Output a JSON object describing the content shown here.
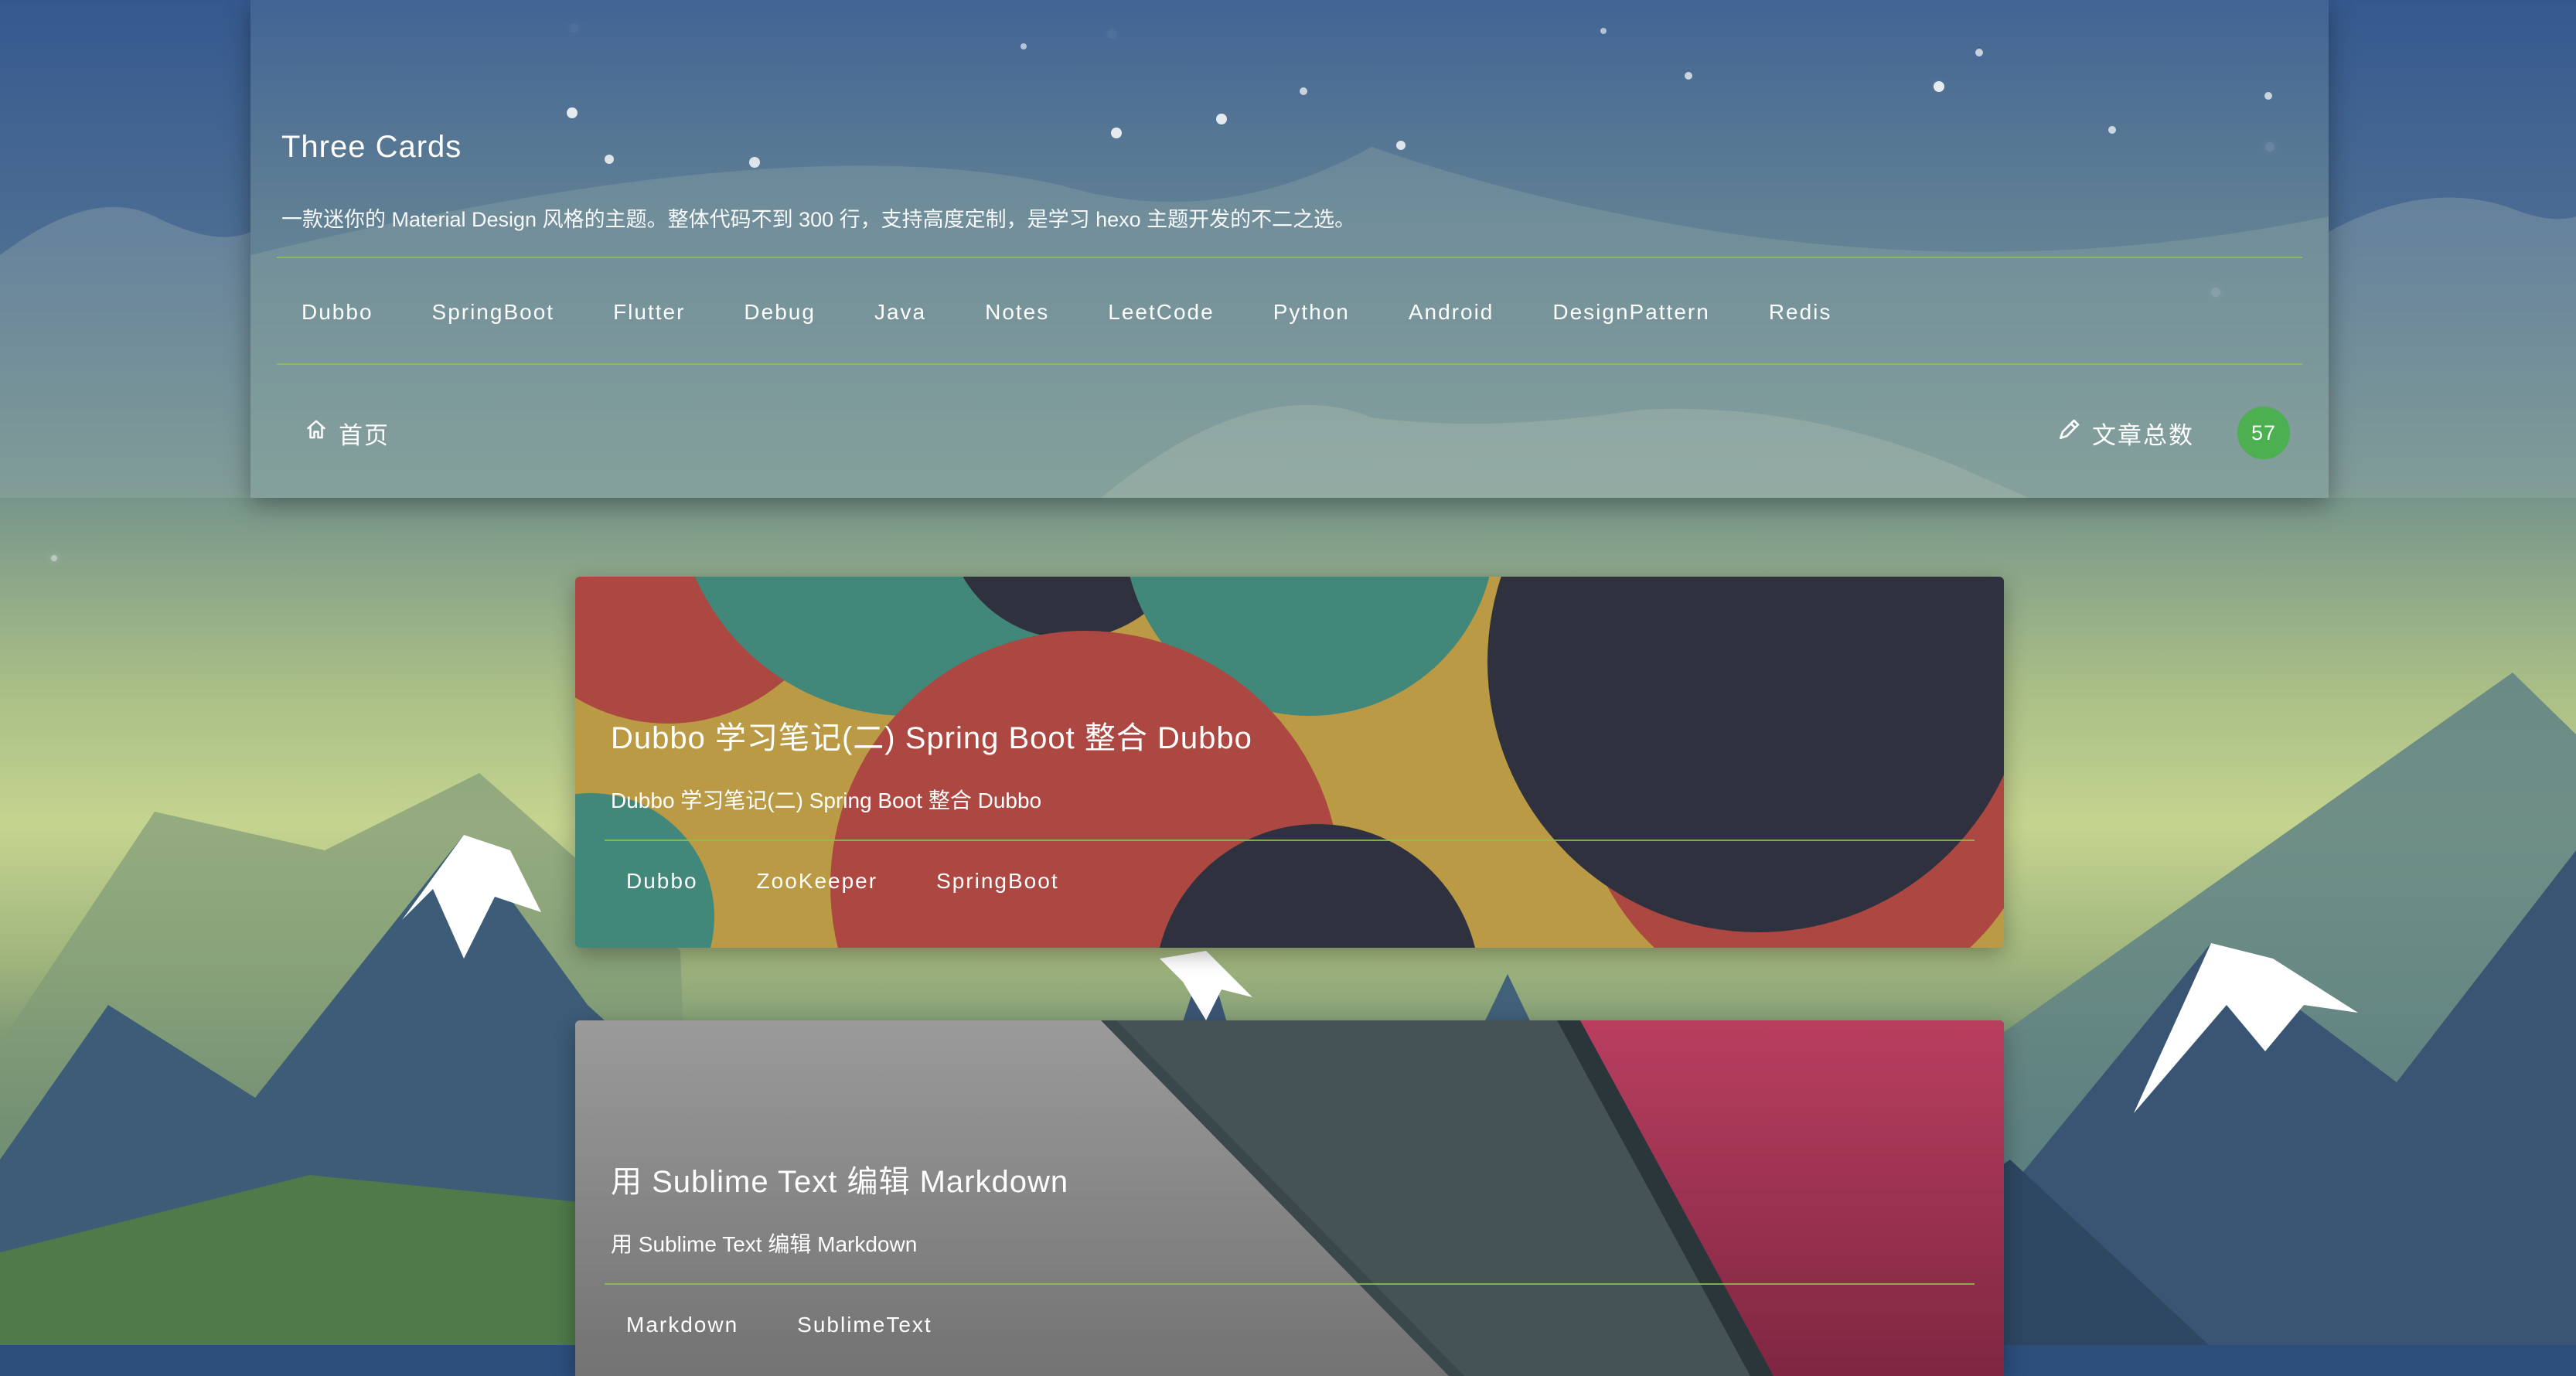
{
  "header": {
    "title": "Three Cards",
    "description": "一款迷你的 Material Design 风格的主题。整体代码不到 300 行，支持高度定制，是学习 hexo 主题开发的不二之选。",
    "tags": [
      "Dubbo",
      "SpringBoot",
      "Flutter",
      "Debug",
      "Java",
      "Notes",
      "LeetCode",
      "Python",
      "Android",
      "DesignPattern",
      "Redis"
    ],
    "nav_home_label": "首页",
    "nav_home_icon": "home-icon",
    "post_count_label": "文章总数",
    "post_count_icon": "edit-icon",
    "post_count": "57"
  },
  "posts": [
    {
      "title": "Dubbo 学习笔记(二) Spring Boot 整合 Dubbo",
      "subtitle": "Dubbo 学习笔记(二) Spring Boot 整合 Dubbo",
      "tags": [
        "Dubbo",
        "ZooKeeper",
        "SpringBoot"
      ]
    },
    {
      "title": "用 Sublime Text 编辑 Markdown",
      "subtitle": "用 Sublime Text 编辑 Markdown",
      "tags": [
        "Markdown",
        "SublimeText"
      ]
    }
  ],
  "colors": {
    "accent_line": "#8bc34a",
    "badge": "#4caf50",
    "card1_red": "#c4534b",
    "card1_teal": "#4a9a8b",
    "card1_yellow": "#d4b04e",
    "card1_dark": "#363a47",
    "card2_gray": "#9a9a9a",
    "card2_slate": "#4b5a5e",
    "card2_pink": "#c23f63"
  }
}
